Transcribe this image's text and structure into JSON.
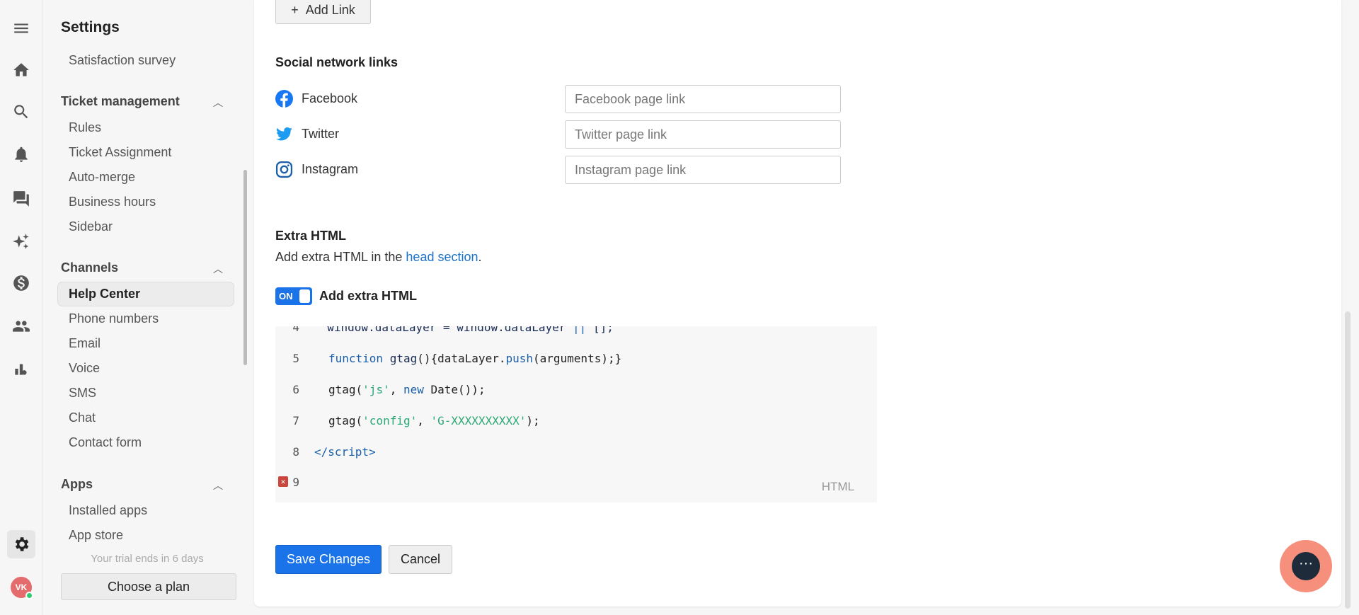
{
  "rail": {
    "icons": [
      "menu-icon",
      "home-icon",
      "search-icon",
      "bell-icon",
      "chat-icon",
      "sparkle-icon",
      "dollar-icon",
      "people-icon",
      "chart-icon",
      "gear-icon"
    ],
    "avatar": "VK"
  },
  "sidebar": {
    "title": "Settings",
    "top_item": "Satisfaction survey",
    "sections": [
      {
        "label": "Ticket management",
        "items": [
          "Rules",
          "Ticket Assignment",
          "Auto-merge",
          "Business hours",
          "Sidebar"
        ]
      },
      {
        "label": "Channels",
        "items": [
          "Help Center",
          "Phone numbers",
          "Email",
          "Voice",
          "SMS",
          "Chat",
          "Contact form"
        ]
      },
      {
        "label": "Apps",
        "items": [
          "Installed apps",
          "App store"
        ]
      }
    ],
    "active": "Help Center",
    "trial": "Your trial ends in 6 days",
    "plan_button": "Choose a plan"
  },
  "main": {
    "add_link": "Add Link",
    "social_title": "Social network links",
    "social": [
      {
        "label": "Facebook",
        "placeholder": "Facebook page link",
        "color": "#1877f2"
      },
      {
        "label": "Twitter",
        "placeholder": "Twitter page link",
        "color": "#1d9bf0"
      },
      {
        "label": "Instagram",
        "placeholder": "Instagram page link",
        "color": "#1a5fa8"
      }
    ],
    "extra_title": "Extra HTML",
    "extra_desc_pre": "Add extra HTML in the ",
    "extra_desc_link": "head section",
    "extra_desc_post": ".",
    "toggle": {
      "state": "ON",
      "label": "Add extra HTML"
    },
    "code": {
      "language": "HTML",
      "lines": [
        {
          "n": "4",
          "text": "  window.dataLayer = window.dataLayer || [];"
        },
        {
          "n": "5",
          "text": "  function gtag(){dataLayer.push(arguments);}"
        },
        {
          "n": "6",
          "text": "  gtag('js', new Date());"
        },
        {
          "n": "7",
          "text": "  gtag('config', 'G-XXXXXXXXXX');"
        },
        {
          "n": "8",
          "text": "</script>"
        },
        {
          "n": "9",
          "text": ""
        }
      ]
    },
    "save": "Save Changes",
    "cancel": "Cancel"
  }
}
